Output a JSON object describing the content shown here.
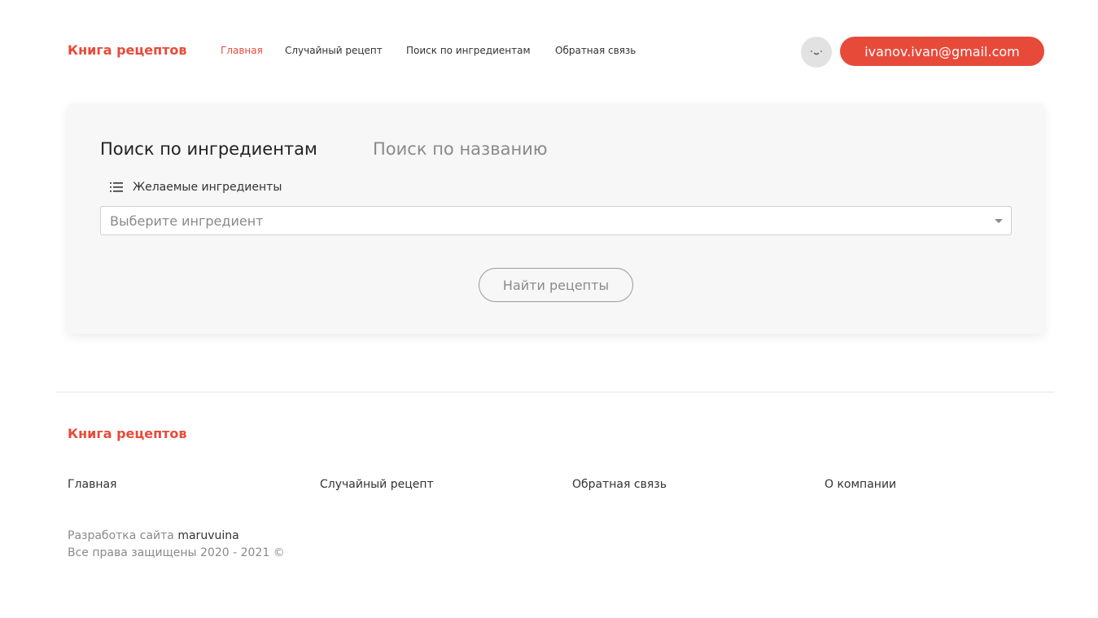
{
  "header": {
    "logo": "Книга рецептов",
    "nav": [
      {
        "label": "Главная",
        "active": true
      },
      {
        "label": "Случайный рецепт",
        "active": false
      },
      {
        "label": "Поиск по ингредиентам",
        "active": false
      },
      {
        "label": "Обратная связь",
        "active": false
      }
    ],
    "avatar_icon": "smiley-face-icon",
    "user_email": "ivanov.ivan@gmail.com"
  },
  "search": {
    "tabs": [
      {
        "label": "Поиск по ингредиентам",
        "active": true
      },
      {
        "label": "Поиск по названию",
        "active": false
      }
    ],
    "field_icon": "list-icon",
    "field_label": "Желаемые ингредиенты",
    "select_placeholder": "Выберите ингредиент",
    "submit_label": "Найти рецепты"
  },
  "footer": {
    "logo": "Книга рецептов",
    "links": [
      "Главная",
      "Случайный рецепт",
      "Обратная связь",
      "О компании"
    ],
    "credits_prefix": "Разработка сайта",
    "credits_author": "maruvuina",
    "copyright": "Все права защищены 2020 - 2021 ©"
  },
  "colors": {
    "accent": "#e84a3a",
    "card_bg": "#f7f7f7",
    "muted": "#8a8a8a"
  }
}
